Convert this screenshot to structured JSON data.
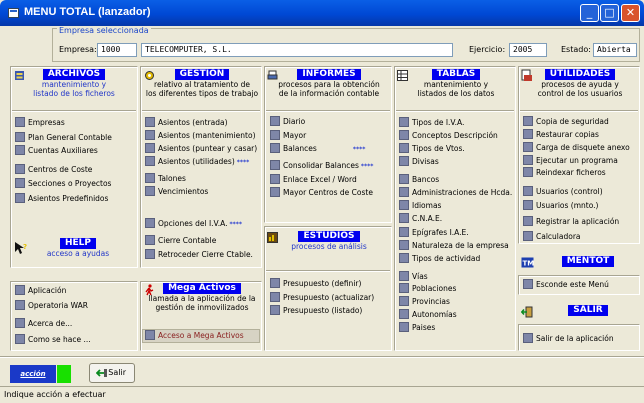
{
  "window": {
    "title": "MENU TOTAL (lanzador)"
  },
  "empresa": {
    "legend": "Empresa seleccionada",
    "empresa_label": "Empresa:",
    "empresa_code": "1000",
    "empresa_name": "TELECOMPUTER, S.L.",
    "ejercicio_label": "Ejercicio:",
    "ejercicio_value": "2005",
    "estado_label": "Estado:",
    "estado_value": "Abierta"
  },
  "archivos": {
    "title": "ARCHIVOS",
    "sub1": "mantenimiento y",
    "sub2": "listado de los ficheros",
    "items": [
      "Empresas",
      "Plan General Contable",
      "Cuentas Auxiliares",
      "Centros de Coste",
      "Secciones o Proyectos",
      "Asientos Predefinidos"
    ]
  },
  "help": {
    "title": "HELP",
    "sub": "acceso a ayudas",
    "items": [
      "Aplicación",
      "Operatoria WAR",
      "Acerca de...",
      "Como se hace ..."
    ]
  },
  "gestion": {
    "title": "GESTIÓN",
    "sub1": "relativo al tratamiento de",
    "sub2": "los diferentes tipos de trabajo",
    "items": [
      "Asientos (entrada)",
      "Asientos (mantenimiento)",
      "Asientos (puntear y casar)",
      "Asientos (utilidades)",
      "Talones",
      "Vencimientos"
    ],
    "items2": [
      "Opciones del I.V.A.",
      "Cierre Contable",
      "Retroceder Cierre Ctable."
    ]
  },
  "mega": {
    "title": "Mega Activos",
    "sub1": "llamada a la aplicación de la",
    "sub2": "gestión de inmovilizados",
    "item": "Acceso a Mega Activos"
  },
  "informes": {
    "title": "INFORMES",
    "sub1": "procesos para la obtención",
    "sub2": "de la información contable",
    "items": [
      "Diario",
      "Mayor",
      "Balances",
      "Consolidar Balances",
      "Enlace Excel / Word",
      "Mayor Centros de Coste"
    ]
  },
  "estudios": {
    "title": "ESTUDIOS",
    "sub": "procesos de análisis",
    "items": [
      "Presupuesto (definir)",
      "Presupuesto (actualizar)",
      "Presupuesto (listado)"
    ]
  },
  "tablas": {
    "title": "TABLAS",
    "sub1": "mantenimiento y",
    "sub2": "listados de los datos",
    "items": [
      "Tipos de I.V.A.",
      "Conceptos Descripción",
      "Tipos de Vtos.",
      "Divisas",
      "Bancos",
      "Administraciones de Hcda.",
      "Idiomas",
      "C.N.A.E.",
      "Epígrafes I.A.E.",
      "Naturaleza de la empresa",
      "Tipos de actividad",
      "Vías",
      "Poblaciones",
      "Provincias",
      "Autonomías",
      "Paises"
    ]
  },
  "utilidades": {
    "title": "UTILIDADES",
    "sub1": "procesos de ayuda y",
    "sub2": "control de los usuarios",
    "items": [
      "Copia de seguridad",
      "Restaurar copias",
      "Carga de disquete anexo",
      "Ejecutar un programa",
      "Reindexar ficheros",
      "Usuarios (control)",
      "Usuarios (mnto.)",
      "Registrar la aplicación",
      "Calculadora"
    ]
  },
  "mentot": {
    "title": "MENTOT",
    "item": "Esconde este Menú"
  },
  "salir": {
    "title": "SALIR",
    "item": "Salir de la aplicación"
  },
  "footer": {
    "accion": "acción",
    "salir": "Salir",
    "status": "Indique acción a efectuar"
  },
  "dots": "****"
}
